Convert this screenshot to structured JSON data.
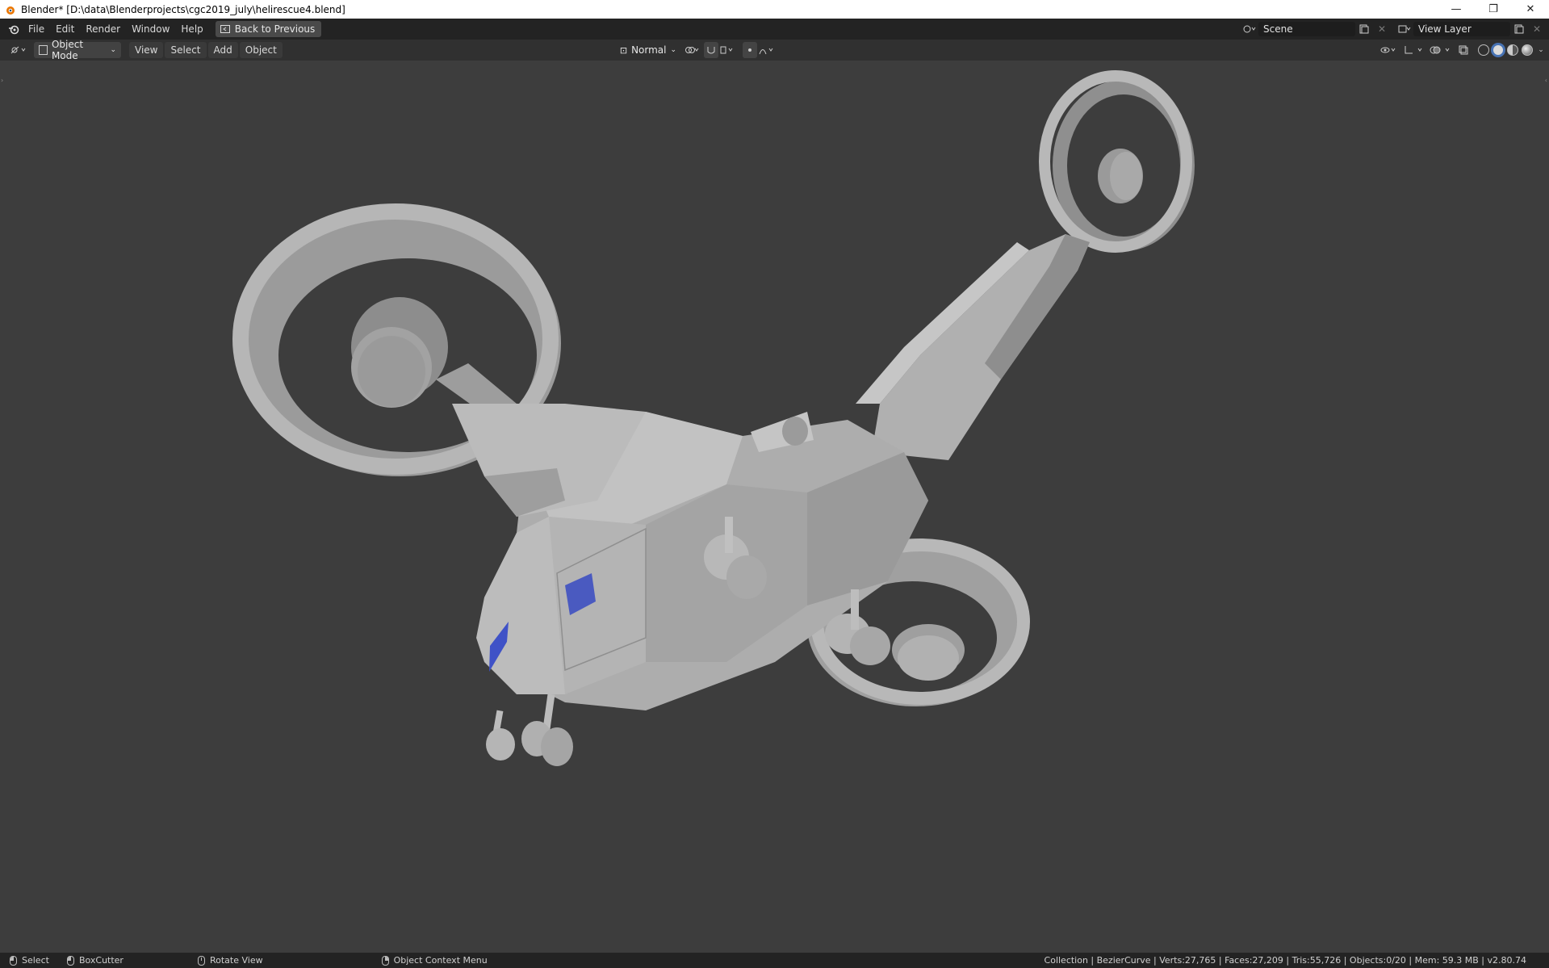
{
  "window": {
    "title": "Blender* [D:\\data\\Blenderprojects\\cgc2019_july\\helirescue4.blend]",
    "minimize": "—",
    "restore": "❐",
    "close": "✕"
  },
  "topbar": {
    "menus": [
      "File",
      "Edit",
      "Render",
      "Window",
      "Help"
    ],
    "back_button": "Back to Previous",
    "scene_name": "Scene",
    "view_layer": "View Layer"
  },
  "header": {
    "mode": "Object Mode",
    "menus": [
      "View",
      "Select",
      "Add",
      "Object"
    ],
    "orientation": "Normal"
  },
  "statusbar": {
    "select": "Select",
    "boxcutter": "BoxCutter",
    "rotate": "Rotate View",
    "context_menu": "Object Context Menu",
    "stats": "Collection | BezierCurve | Verts:27,765 | Faces:27,209 | Tris:55,726 | Objects:0/20 | Mem: 59.3 MB | v2.80.74"
  },
  "colors": {
    "accent": "#4772b3",
    "viewport_bg": "#3d3d3d",
    "model_gray": "#a6a6a6",
    "window_blue": "#3f52c7"
  },
  "icons": [
    "blender-logo-icon",
    "editor-type-icon",
    "object-mode-icon",
    "orientation-icon",
    "pivot-icon",
    "snap-icon",
    "proportional-icon",
    "visibility-icon",
    "gizmo-icon",
    "overlay-icon",
    "xray-icon",
    "wireframe-shading-icon",
    "solid-shading-icon",
    "material-shading-icon",
    "rendered-shading-icon"
  ]
}
